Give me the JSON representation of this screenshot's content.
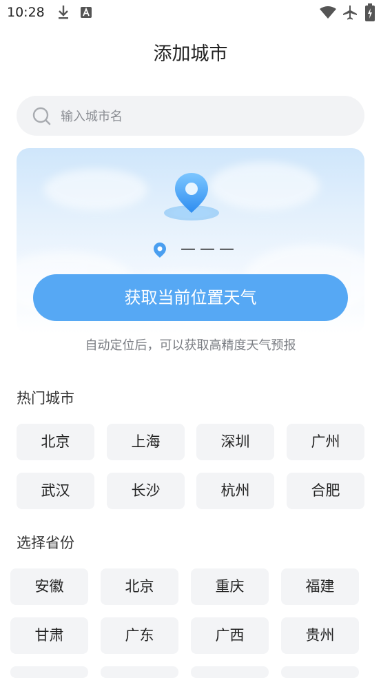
{
  "status_bar": {
    "time": "10:28"
  },
  "header": {
    "title": "添加城市"
  },
  "search": {
    "placeholder": "输入城市名",
    "value": ""
  },
  "location_card": {
    "current_location": "———",
    "button_label": "获取当前位置天气",
    "hint": "自动定位后，可以获取高精度天气预报"
  },
  "hot_cities": {
    "title": "热门城市",
    "items": [
      "北京",
      "上海",
      "深圳",
      "广州",
      "武汉",
      "长沙",
      "杭州",
      "合肥"
    ]
  },
  "provinces": {
    "title": "选择省份",
    "items": [
      "安徽",
      "北京",
      "重庆",
      "福建",
      "甘肃",
      "广东",
      "广西",
      "贵州"
    ]
  },
  "colors": {
    "accent": "#56a8f4",
    "chip_bg": "#f3f4f6",
    "search_bg": "#f2f3f5"
  }
}
